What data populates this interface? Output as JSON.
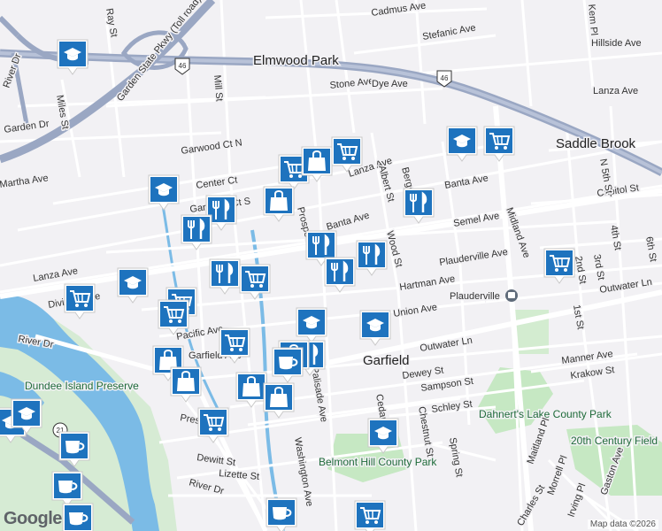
{
  "map": {
    "attribution": "Map data ©2026",
    "logo": "Google",
    "places": [
      {
        "name": "Elmwood Park",
        "kind": "town"
      },
      {
        "name": "Saddle Brook",
        "kind": "town"
      },
      {
        "name": "Garfield",
        "kind": "town"
      },
      {
        "name": "Plauderville",
        "kind": "station"
      }
    ],
    "parks": [
      "Dundee Island Preserve",
      "Dahnert's Lake County Park",
      "20th Century Field",
      "Belmont Hill County Park"
    ],
    "highway_shields": [
      "46",
      "46",
      "21"
    ],
    "streets": [
      "Garden State Pkwy (Toll road)",
      "Cadmus Ave",
      "Stefanic Ave",
      "Hillside Ave",
      "Stone Ave",
      "Dye Ave",
      "Lanza Ave",
      "Lanza Ave",
      "Lanza Ave",
      "Banta Ave",
      "Banta Ave",
      "Semel Ave",
      "Plauderville Ave",
      "Hartman Ave",
      "Union Ave",
      "Outwater Ln",
      "Outwater Ln",
      "Manner Ave",
      "Krakow St",
      "Dewey St",
      "Sampson St",
      "Schley St",
      "Garwood Ct N",
      "Center Ct",
      "Garwood Ct S",
      "Martha Ave",
      "Midland Ave",
      "Albert St",
      "Wood St",
      "Prospect St",
      "Palisade Ave",
      "Washington Ave",
      "Chestnut St",
      "Spring St",
      "Cedar St",
      "River Dr",
      "River Dr",
      "River Dr",
      "Pacific Ave",
      "Garfield Ave",
      "Mill St",
      "Miles St",
      "Garden Dr",
      "Capitol St",
      "N 5th St",
      "4th St",
      "3rd St",
      "2nd St",
      "1st St",
      "6th St",
      "Kem Pl",
      "Dewitt St",
      "Lizette St",
      "Preston St",
      "Division Ave",
      "Maitland Pl",
      "Morrell Pl",
      "Irving Pl",
      "Gaston Ave",
      "Charles St",
      "Ray St",
      "Bergen Ave"
    ],
    "poi_categories": {
      "school": "graduation-cap-icon",
      "grocery": "shopping-cart-icon",
      "restaurant": "fork-knife-icon",
      "shopping": "shopping-bag-icon",
      "cafe": "coffee-cup-icon"
    },
    "colors": {
      "land": "#f2f1f4",
      "water": "#7bbbe6",
      "park": "#c6e8c3",
      "highway": "#9aa7c3",
      "poi": "#1e73be"
    }
  }
}
